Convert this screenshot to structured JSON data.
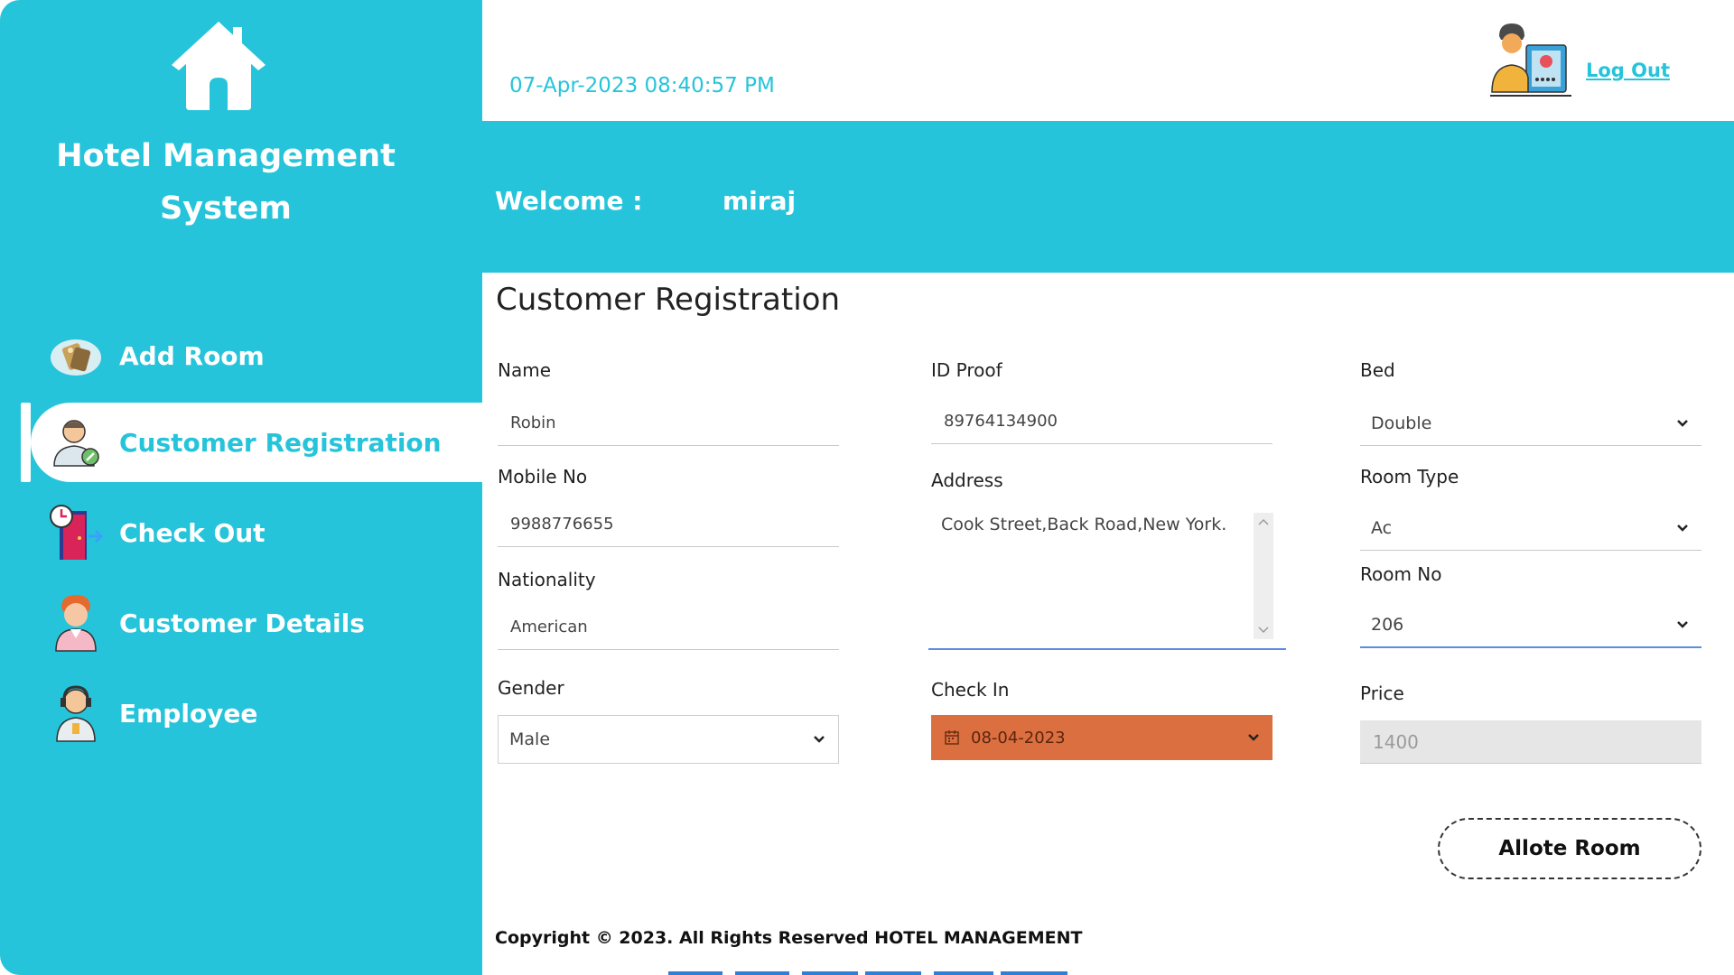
{
  "app": {
    "title": "Hotel Management System",
    "accent_color": "#26c4da",
    "logo_icon": "house-icon"
  },
  "sidebar": {
    "items": [
      {
        "label": "Add Room",
        "icon": "room-keys-icon",
        "active": false
      },
      {
        "label": "Customer Registration",
        "icon": "customer-register-icon",
        "active": true
      },
      {
        "label": "Check Out",
        "icon": "checkout-door-clock-icon",
        "active": false
      },
      {
        "label": "Customer Details",
        "icon": "customer-person-icon",
        "active": false
      },
      {
        "label": "Employee",
        "icon": "employee-headset-icon",
        "active": false
      }
    ]
  },
  "header": {
    "datetime": "07-Apr-2023 08:40:57 PM",
    "logout_label": "Log Out",
    "avatar_icon": "user-profile-card-icon"
  },
  "welcome": {
    "label": "Welcome :",
    "username": "miraj"
  },
  "form": {
    "title": "Customer Registration",
    "name": {
      "label": "Name",
      "value": "Robin"
    },
    "mobile": {
      "label": "Mobile No",
      "value": "9988776655"
    },
    "nationality": {
      "label": "Nationality",
      "value": "American"
    },
    "gender": {
      "label": "Gender",
      "value": "Male"
    },
    "id_proof": {
      "label": "ID Proof",
      "value": "89764134900"
    },
    "address": {
      "label": "Address",
      "value": "Cook Street,Back Road,New York."
    },
    "check_in": {
      "label": "Check In",
      "value": "08-04-2023",
      "color": "#dc6f3f"
    },
    "bed": {
      "label": "Bed",
      "value": "Double"
    },
    "room_type": {
      "label": "Room Type",
      "value": "Ac"
    },
    "room_no": {
      "label": "Room No",
      "value": "206"
    },
    "price": {
      "label": "Price",
      "value": "1400"
    },
    "submit_label": "Allote Room"
  },
  "footer": {
    "copyright": "Copyright © 2023. All Rights Reserved HOTEL MANAGEMENT"
  }
}
